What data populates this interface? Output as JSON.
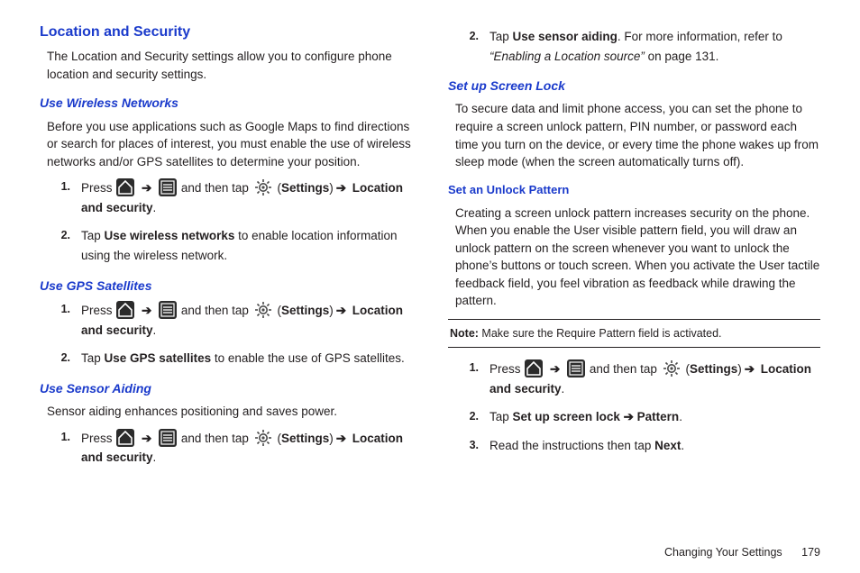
{
  "left": {
    "heading": "Location and Security",
    "intro": "The Location and Security settings allow you to configure phone location and security settings.",
    "wireless": {
      "heading": "Use Wireless Networks",
      "intro": "Before you use applications such as Google Maps to find directions or search for places of interest, you must enable the use of wireless networks and/or GPS satellites to determine your position.",
      "step1_press": "Press ",
      "step1_andthen": " and then tap ",
      "step1_settings": "Settings",
      "step1_locsec": "Location and security",
      "step2_a": "Tap ",
      "step2_b": "Use wireless networks",
      "step2_c": " to enable location information using the wireless network."
    },
    "gps": {
      "heading": "Use GPS Satellites",
      "step1_press": "Press ",
      "step1_andthen": " and then tap ",
      "step1_settings": "Settings",
      "step1_locsec": "Location and security",
      "step2_a": "Tap ",
      "step2_b": "Use GPS satellites",
      "step2_c": " to enable the use of GPS satellites."
    },
    "sensor": {
      "heading": "Use Sensor Aiding",
      "intro": "Sensor aiding enhances positioning and saves power.",
      "step1_press": "Press ",
      "step1_andthen": " and then tap ",
      "step1_settings": "Settings",
      "step1_locsec": "Location and security"
    }
  },
  "right": {
    "step2_a": "Tap ",
    "step2_b": "Use sensor aiding",
    "step2_c": ". For more information, refer to ",
    "step2_ref": "“Enabling a Location source”",
    "step2_page": "  on page 131.",
    "screenlock": {
      "heading": "Set up Screen Lock",
      "intro": "To secure data and limit phone access, you can set the phone to require a screen unlock pattern, PIN number, or password each time you turn on the device, or every time the phone wakes up from sleep mode (when the screen automatically turns off)."
    },
    "unlock": {
      "heading": "Set an Unlock Pattern",
      "intro": "Creating a screen unlock pattern increases security on the phone. When you enable the User visible pattern field, you will draw an unlock pattern on the screen whenever you want to unlock the phone’s buttons or touch screen. When you activate the User tactile feedback field, you feel vibration as feedback while drawing the pattern.",
      "note_label": "Note:",
      "note_text": " Make sure the Require Pattern field is activated.",
      "step1_press": "Press ",
      "step1_andthen": " and then tap ",
      "step1_settings": "Settings",
      "step1_locsec": "Location and security",
      "step2_a": "Tap ",
      "step2_b": "Set up screen lock",
      "step2_arrow": " ➔ ",
      "step2_c": "Pattern",
      "step3_a": "Read the instructions then tap ",
      "step3_b": "Next"
    }
  },
  "nums": {
    "n1": "1.",
    "n2": "2.",
    "n3": "3."
  },
  "arrow": "➔",
  "footer": {
    "title": "Changing Your Settings",
    "page": "179"
  }
}
